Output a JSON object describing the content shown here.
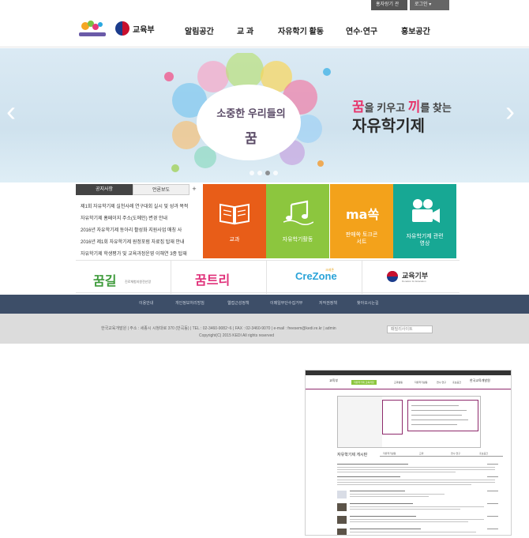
{
  "top_utility": {
    "item1": "홍자랑기 관리",
    "item2": "로그인 ▾"
  },
  "header": {
    "festival_logo_alt": "자유학기제",
    "ministry_logo": "교육부",
    "nav": [
      "알림공간",
      "교 과",
      "자유학기 활동",
      "연수·연구",
      "홍보공간"
    ]
  },
  "hero": {
    "bubble_line1": "소중한 우리들의",
    "bubble_line2": "꿈",
    "tagline_prefix": "꿈",
    "tagline_mid": "을 키우고 ",
    "tagline_hl2": "끼",
    "tagline_suffix": "를 찾는",
    "title": "자유학기제",
    "slide_count": 4,
    "active_slide": 3
  },
  "news": {
    "tabs": [
      "공지사항",
      "언론보도",
      "+"
    ],
    "items": [
      "제1회 자유학기제 실천사례 연구대회 실시 및 성과 목적",
      "자유학기제 홈페이지 주소(도메인) 변경 안내",
      "2016년 자유학기제 동아리 활성화 지원사업 매칭 사",
      "2016년 제1회 자유학기제 원정포럼 자료집 탑재 안내",
      "자유학기제 학생평가 및 교육과정운영 이해연 3종 탑재"
    ]
  },
  "tiles": [
    {
      "label": "교과",
      "color": "#e85d18",
      "icon": "book-icon"
    },
    {
      "label": "자유학기활동",
      "color": "#8cc63e",
      "icon": "music-icon"
    },
    {
      "label": "판매쏙 토크콘서트",
      "color": "#f3a21b",
      "icon": "talk-concert-logo"
    },
    {
      "label": "자유학기제 관련영상",
      "color": "#17a894",
      "icon": "video-camera-icon"
    }
  ],
  "banners": [
    {
      "label": "꿈길",
      "sub": "진로체험지원전산망"
    },
    {
      "label": "꿈트리"
    },
    {
      "label": "CreZone",
      "sub": "크레존"
    },
    {
      "label": "교육기부",
      "sub": "Donation for Education"
    }
  ],
  "footer_nav": [
    "이용안내",
    "개인정보처리방침",
    "웹접근성정책",
    "이메일무단수집거부",
    "저작권정책",
    "찾아오시는길"
  ],
  "footer": {
    "address": "한국교육개발원 | 주소 : 세종시 시청대로 370 (반곡동) | TEL : 02-3460-9082~6 | FAX : 02-3460-9070 | e-mail : freesem@kedi.re.kr | admin",
    "copyright": "Copyright(C) 2015 KEDI All rights reserved",
    "family_site": "패밀리사이트"
  },
  "thumbnail": {
    "logo": "교육부",
    "nav": [
      "자유학기제 교육과정",
      "교과활동",
      "자유학기활동",
      "연수·연구",
      "홍보공간"
    ],
    "right_label": "한국교육개발원",
    "board_title": "자유학기제 게시판",
    "tabs": [
      "자유학기활동",
      "교과",
      "연수·연구",
      "홍보공간"
    ]
  }
}
